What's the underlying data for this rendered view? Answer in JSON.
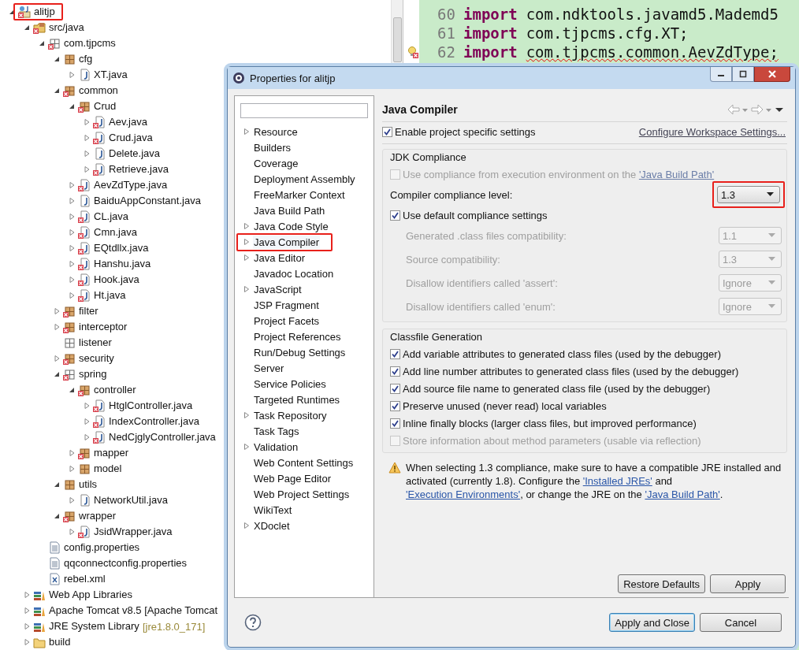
{
  "explorer": {
    "tree": [
      {
        "label": "alitjp",
        "kind": "project",
        "error": true,
        "expanded": true,
        "highlighted": true,
        "children": [
          {
            "label": "src/java",
            "kind": "srcfolder",
            "error": true,
            "expanded": true,
            "children": [
              {
                "label": "com.tjpcms",
                "kind": "package-empty",
                "error": true,
                "expanded": true,
                "children": [
                  {
                    "label": "cfg",
                    "kind": "package",
                    "error": false,
                    "expanded": true,
                    "children": [
                      {
                        "label": "XT.java",
                        "kind": "java",
                        "error": false,
                        "expanded": false
                      }
                    ]
                  },
                  {
                    "label": "common",
                    "kind": "package",
                    "error": true,
                    "expanded": true,
                    "children": [
                      {
                        "label": "Crud",
                        "kind": "package",
                        "error": true,
                        "expanded": true,
                        "children": [
                          {
                            "label": "Aev.java",
                            "kind": "java",
                            "error": true,
                            "expanded": false
                          },
                          {
                            "label": "Crud.java",
                            "kind": "java",
                            "error": true,
                            "expanded": false
                          },
                          {
                            "label": "Delete.java",
                            "kind": "java",
                            "error": false,
                            "expanded": false
                          },
                          {
                            "label": "Retrieve.java",
                            "kind": "java",
                            "error": true,
                            "expanded": false
                          }
                        ]
                      },
                      {
                        "label": "AevZdType.java",
                        "kind": "java",
                        "error": true,
                        "expanded": false
                      },
                      {
                        "label": "BaiduAppConstant.java",
                        "kind": "java",
                        "error": false,
                        "expanded": false
                      },
                      {
                        "label": "CL.java",
                        "kind": "java",
                        "error": true,
                        "expanded": false
                      },
                      {
                        "label": "Cmn.java",
                        "kind": "java",
                        "error": true,
                        "expanded": false
                      },
                      {
                        "label": "EQtdllx.java",
                        "kind": "java",
                        "error": true,
                        "expanded": false
                      },
                      {
                        "label": "Hanshu.java",
                        "kind": "java",
                        "error": true,
                        "expanded": false
                      },
                      {
                        "label": "Hook.java",
                        "kind": "java",
                        "error": true,
                        "expanded": false
                      },
                      {
                        "label": "Ht.java",
                        "kind": "java",
                        "error": true,
                        "expanded": false
                      }
                    ]
                  },
                  {
                    "label": "filter",
                    "kind": "package",
                    "error": true,
                    "expanded": false
                  },
                  {
                    "label": "interceptor",
                    "kind": "package",
                    "error": true,
                    "expanded": false
                  },
                  {
                    "label": "listener",
                    "kind": "package-empty",
                    "error": false
                  },
                  {
                    "label": "security",
                    "kind": "package",
                    "error": true,
                    "expanded": false
                  },
                  {
                    "label": "spring",
                    "kind": "package-empty",
                    "error": true,
                    "expanded": true,
                    "children": [
                      {
                        "label": "controller",
                        "kind": "package",
                        "error": true,
                        "expanded": true,
                        "children": [
                          {
                            "label": "HtglController.java",
                            "kind": "java",
                            "error": true,
                            "expanded": false
                          },
                          {
                            "label": "IndexController.java",
                            "kind": "java",
                            "error": true,
                            "expanded": false
                          },
                          {
                            "label": "NedCjglyController.java",
                            "kind": "java",
                            "error": true,
                            "expanded": false
                          }
                        ]
                      },
                      {
                        "label": "mapper",
                        "kind": "package",
                        "error": true,
                        "expanded": false
                      },
                      {
                        "label": "model",
                        "kind": "package",
                        "error": false,
                        "expanded": false
                      }
                    ]
                  },
                  {
                    "label": "utils",
                    "kind": "package",
                    "error": false,
                    "expanded": true,
                    "children": [
                      {
                        "label": "NetworkUtil.java",
                        "kind": "java",
                        "error": false,
                        "expanded": false
                      }
                    ]
                  },
                  {
                    "label": "wrapper",
                    "kind": "package",
                    "error": true,
                    "expanded": true,
                    "children": [
                      {
                        "label": "JsidWrapper.java",
                        "kind": "java",
                        "error": true,
                        "expanded": false
                      }
                    ]
                  }
                ]
              },
              {
                "label": "config.properties",
                "kind": "properties",
                "error": false
              },
              {
                "label": "qqconnectconfig.properties",
                "kind": "properties",
                "error": false
              },
              {
                "label": "rebel.xml",
                "kind": "xml",
                "error": false
              }
            ]
          },
          {
            "label": "Web App Libraries",
            "kind": "library",
            "error": false,
            "expanded": false
          },
          {
            "label": "Apache Tomcat v8.5 [Apache Tomcat",
            "kind": "library",
            "error": false,
            "expanded": false
          },
          {
            "label": "JRE System Library",
            "decoration": "[jre1.8.0_171]",
            "kind": "library",
            "error": false,
            "expanded": false
          },
          {
            "label": "build",
            "kind": "folder",
            "error": false,
            "expanded": false
          }
        ]
      }
    ]
  },
  "editor": {
    "lines": [
      {
        "number": "60",
        "keyword": "import",
        "code": "com.ndktools.javamd5.Mademd5",
        "error": false
      },
      {
        "number": "61",
        "keyword": "import",
        "code": "com.tjpcms.cfg.XT;",
        "error": false
      },
      {
        "number": "62",
        "keyword": "import",
        "code": "com.tjpcms.common.AevZdType;",
        "error": true
      }
    ]
  },
  "dialog": {
    "title": "Properties for alitjp",
    "nav": [
      {
        "label": "Resource",
        "expandable": true,
        "selected": false,
        "highlighted": false
      },
      {
        "label": "Builders",
        "expandable": false,
        "selected": false,
        "highlighted": false
      },
      {
        "label": "Coverage",
        "expandable": false,
        "selected": false,
        "highlighted": false
      },
      {
        "label": "Deployment Assembly",
        "expandable": false,
        "selected": false,
        "highlighted": false
      },
      {
        "label": "FreeMarker Context",
        "expandable": false,
        "selected": false,
        "highlighted": false
      },
      {
        "label": "Java Build Path",
        "expandable": false,
        "selected": false,
        "highlighted": false
      },
      {
        "label": "Java Code Style",
        "expandable": true,
        "selected": false,
        "highlighted": false
      },
      {
        "label": "Java Compiler",
        "expandable": true,
        "selected": true,
        "highlighted": true
      },
      {
        "label": "Java Editor",
        "expandable": true,
        "selected": false,
        "highlighted": false
      },
      {
        "label": "Javadoc Location",
        "expandable": false,
        "selected": false,
        "highlighted": false
      },
      {
        "label": "JavaScript",
        "expandable": true,
        "selected": false,
        "highlighted": false
      },
      {
        "label": "JSP Fragment",
        "expandable": false,
        "selected": false,
        "highlighted": false
      },
      {
        "label": "Project Facets",
        "expandable": false,
        "selected": false,
        "highlighted": false
      },
      {
        "label": "Project References",
        "expandable": false,
        "selected": false,
        "highlighted": false
      },
      {
        "label": "Run/Debug Settings",
        "expandable": false,
        "selected": false,
        "highlighted": false
      },
      {
        "label": "Server",
        "expandable": false,
        "selected": false,
        "highlighted": false
      },
      {
        "label": "Service Policies",
        "expandable": false,
        "selected": false,
        "highlighted": false
      },
      {
        "label": "Targeted Runtimes",
        "expandable": false,
        "selected": false,
        "highlighted": false
      },
      {
        "label": "Task Repository",
        "expandable": true,
        "selected": false,
        "highlighted": false
      },
      {
        "label": "Task Tags",
        "expandable": false,
        "selected": false,
        "highlighted": false
      },
      {
        "label": "Validation",
        "expandable": true,
        "selected": false,
        "highlighted": false
      },
      {
        "label": "Web Content Settings",
        "expandable": false,
        "selected": false,
        "highlighted": false
      },
      {
        "label": "Web Page Editor",
        "expandable": false,
        "selected": false,
        "highlighted": false
      },
      {
        "label": "Web Project Settings",
        "expandable": false,
        "selected": false,
        "highlighted": false
      },
      {
        "label": "WikiText",
        "expandable": false,
        "selected": false,
        "highlighted": false
      },
      {
        "label": "XDoclet",
        "expandable": true,
        "selected": false,
        "highlighted": false
      }
    ],
    "page": {
      "heading": "Java Compiler",
      "enable": {
        "label": "Enable project specific settings",
        "checked": true
      },
      "workspace_link": "Configure Workspace Settings...",
      "jdk_group": {
        "title": "JDK Compliance",
        "use_ee": {
          "label": "Use compliance from execution environment on the ",
          "link": "'Java Build Path'",
          "checked": false,
          "disabled": true
        },
        "level": {
          "label": "Compiler compliance level:",
          "value": "1.3",
          "highlighted": true
        },
        "use_default": {
          "label": "Use default compliance settings",
          "checked": true
        },
        "settings": [
          {
            "label": "Generated .class files compatibility:",
            "value": "1.1",
            "disabled": true
          },
          {
            "label": "Source compatibility:",
            "value": "1.3",
            "disabled": true
          },
          {
            "label": "Disallow identifiers called 'assert':",
            "value": "Ignore",
            "disabled": true
          },
          {
            "label": "Disallow identifiers called 'enum':",
            "value": "Ignore",
            "disabled": true
          }
        ]
      },
      "classfile_group": {
        "title": "Classfile Generation",
        "options": [
          {
            "label": "Add variable attributes to generated class files (used by the debugger)",
            "checked": true,
            "disabled": false
          },
          {
            "label": "Add line number attributes to generated class files (used by the debugger)",
            "checked": true,
            "disabled": false
          },
          {
            "label": "Add source file name to generated class file (used by the debugger)",
            "checked": true,
            "disabled": false
          },
          {
            "label": "Preserve unused (never read) local variables",
            "checked": true,
            "disabled": false
          },
          {
            "label": "Inline finally blocks (larger class files, but improved performance)",
            "checked": true,
            "disabled": false
          },
          {
            "label": "Store information about method parameters (usable via reflection)",
            "checked": false,
            "disabled": true
          }
        ]
      },
      "warning": [
        {
          "text": "When selecting 1.3 compliance, make sure to have a compatible JRE installed and activated (currently 1.8). Configure the ",
          "link": false
        },
        {
          "text": "'Installed JREs'",
          "link": true
        },
        {
          "text": " and ",
          "link": false
        },
        {
          "text": "'Execution Environments'",
          "link": true
        },
        {
          "text": ", or change the JRE on the ",
          "link": false
        },
        {
          "text": "'Java Build Path'",
          "link": true
        },
        {
          "text": ".",
          "link": false
        }
      ],
      "page_buttons": [
        {
          "label": "Restore Defaults",
          "default": false
        },
        {
          "label": "Apply",
          "default": false
        }
      ]
    },
    "buttons": [
      {
        "label": "Apply and Close",
        "default": true
      },
      {
        "label": "Cancel",
        "default": false
      }
    ]
  }
}
